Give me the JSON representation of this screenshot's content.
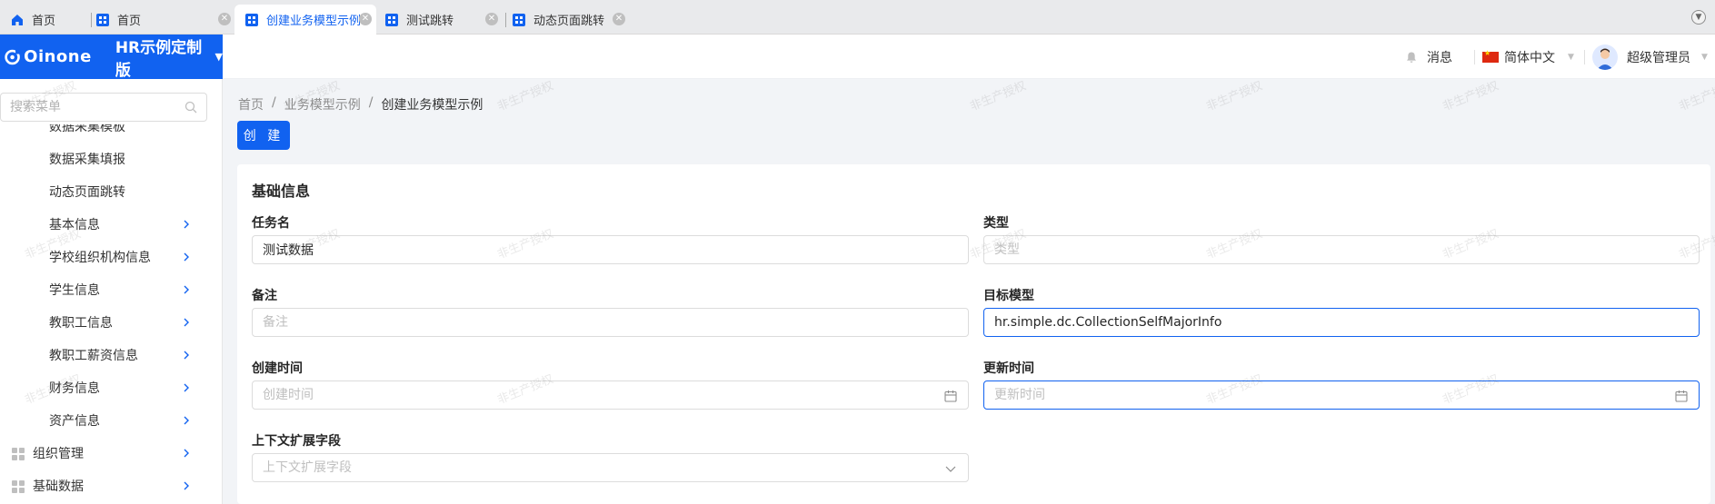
{
  "tabs": [
    {
      "label": "首页",
      "active": false
    },
    {
      "label": "首页",
      "active": false
    },
    {
      "label": "创建业务模型示例",
      "active": true
    },
    {
      "label": "测试跳转",
      "active": false
    },
    {
      "label": "动态页面跳转",
      "active": false
    }
  ],
  "header": {
    "logo": "Oinone",
    "app_name": "HR示例定制版",
    "messages_label": "消息",
    "language_label": "简体中文",
    "user_name": "超级管理员"
  },
  "sidebar": {
    "search_placeholder": "搜索菜单",
    "items": [
      {
        "label": "数据采集模板"
      },
      {
        "label": "数据采集填报"
      },
      {
        "label": "动态页面跳转"
      },
      {
        "label": "基本信息"
      },
      {
        "label": "学校组织机构信息"
      },
      {
        "label": "学生信息"
      },
      {
        "label": "教职工信息"
      },
      {
        "label": "教职工薪资信息"
      },
      {
        "label": "财务信息"
      },
      {
        "label": "资产信息"
      },
      {
        "label": "组织管理"
      },
      {
        "label": "基础数据"
      }
    ]
  },
  "breadcrumb": {
    "items": [
      "首页",
      "业务模型示例",
      "创建业务模型示例"
    ],
    "separator": "/"
  },
  "toolbar": {
    "create_label": "创 建"
  },
  "form": {
    "section_title": "基础信息",
    "task_name": {
      "label": "任务名",
      "value": "测试数据",
      "placeholder": "任务名"
    },
    "type": {
      "label": "类型",
      "value": "",
      "placeholder": "类型"
    },
    "remark": {
      "label": "备注",
      "value": "",
      "placeholder": "备注"
    },
    "target_model": {
      "label": "目标模型",
      "value": "hr.simple.dc.CollectionSelfMajorInfo",
      "placeholder": "目标模型"
    },
    "create_time": {
      "label": "创建时间",
      "value": "",
      "placeholder": "创建时间"
    },
    "update_time": {
      "label": "更新时间",
      "value": "",
      "placeholder": "更新时间"
    },
    "context_ext": {
      "label": "上下文扩展字段",
      "value": "",
      "placeholder": "上下文扩展字段"
    }
  },
  "watermark": "非生产授权",
  "colors": {
    "accent": "#1162f0",
    "page_bg": "#f2f4f7",
    "tabbar_bg": "#e9eaec"
  },
  "icons": {
    "home": "home-icon",
    "tab": "grid-icon",
    "close": "close-icon",
    "bell": "bell-icon",
    "flag": "china-flag-icon",
    "search": "search-icon",
    "chevron": "chevron-right-icon",
    "calendar": "calendar-icon",
    "dropdown": "chevron-down-icon"
  }
}
